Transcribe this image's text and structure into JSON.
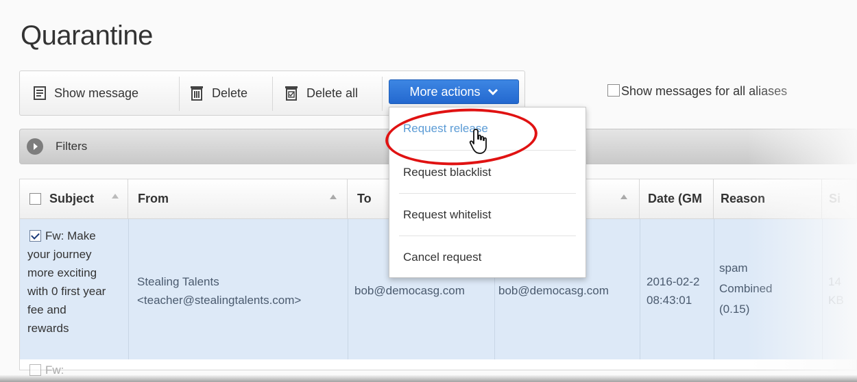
{
  "page": {
    "title": "Quarantine"
  },
  "toolbar": {
    "show_message": "Show message",
    "delete": "Delete",
    "delete_all": "Delete all",
    "more_actions": "More actions",
    "show_aliases": "Show messages for all aliases"
  },
  "filters": {
    "label": "Filters"
  },
  "dropdown": {
    "items": [
      "Request release",
      "Request blacklist",
      "Request whitelist",
      "Cancel request"
    ]
  },
  "table": {
    "headers": {
      "subject": "Subject",
      "from": "From",
      "to": "To",
      "date": "Date (GM",
      "reason": "Reason",
      "size": "Si"
    },
    "row": {
      "subject_lines": [
        "Fw: Make",
        "your journey",
        "more exciting",
        "with 0 first year",
        "fee and",
        "rewards"
      ],
      "from_name": "Stealing Talents",
      "from_email": "<teacher@stealingtalents.com>",
      "to": "bob@democasg.com",
      "recipient": "bob@democasg.com",
      "date_line1": "2016-02-2",
      "date_line2": "08:43:01",
      "reason_lines": [
        "spam",
        "Combined",
        "(0.15)"
      ],
      "size_line1": "14",
      "size_line2": "KB"
    },
    "next_row_partial": "Fw:"
  },
  "colors": {
    "accent": "#2d74d6",
    "highlight_circle": "#e01212",
    "row_selected": "#dde9f7",
    "link_blue": "#5b9bd5"
  }
}
